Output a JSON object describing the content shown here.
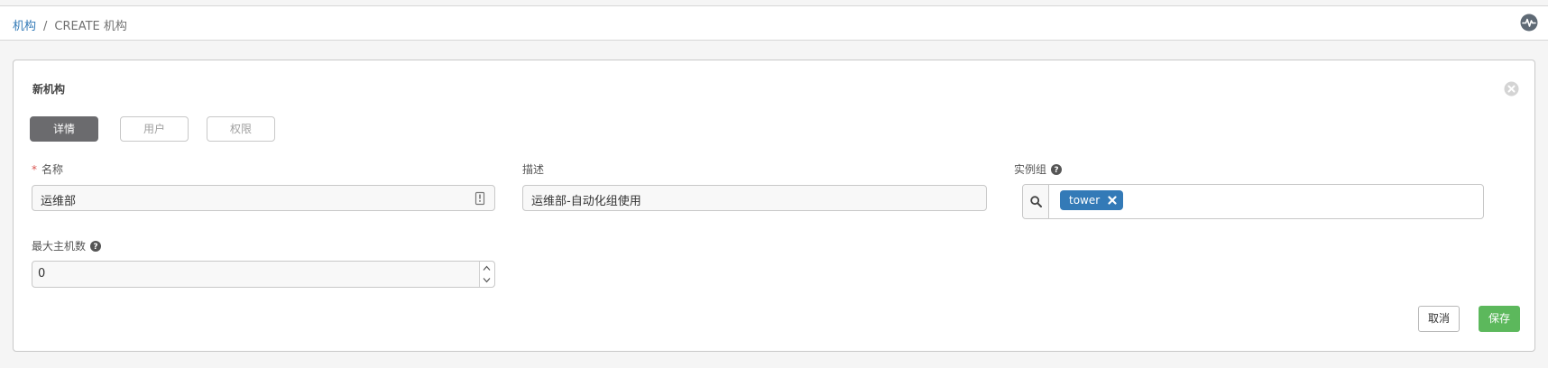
{
  "breadcrumb": {
    "parent": "机构",
    "separator": "/",
    "current": "CREATE 机构"
  },
  "header": {
    "activity_icon": "activity-stream-icon"
  },
  "panel": {
    "title": "新机构",
    "close_icon": "close-icon"
  },
  "tabs": [
    {
      "label": "详情",
      "active": true
    },
    {
      "label": "用户",
      "active": false
    },
    {
      "label": "权限",
      "active": false
    }
  ],
  "form": {
    "name": {
      "label": "名称",
      "required": true,
      "value": "运维部"
    },
    "description": {
      "label": "描述",
      "value": "运维部-自动化组使用"
    },
    "instance_groups": {
      "label": "实例组",
      "selected": [
        "tower"
      ]
    },
    "max_hosts": {
      "label": "最大主机数",
      "value": "0"
    }
  },
  "actions": {
    "cancel_label": "取消",
    "save_label": "保存"
  },
  "colors": {
    "link": "#337ab7",
    "tab_active": "#6b6b6e",
    "tag": "#337ab7",
    "save": "#5cb85c",
    "required": "#d9534f"
  }
}
